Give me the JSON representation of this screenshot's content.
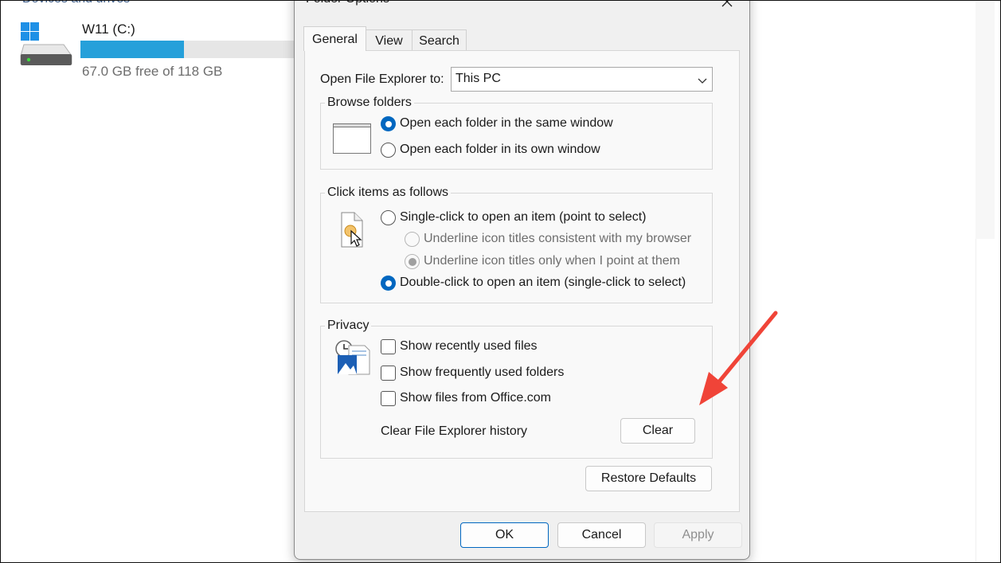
{
  "explorer": {
    "section_header": "Devices and drives",
    "drive": {
      "name": "W11 (C:)",
      "free_text": "67.0 GB free of 118 GB",
      "used_fraction": 0.432
    }
  },
  "dialog": {
    "title": "Folder Options",
    "tabs": [
      {
        "label": "General",
        "active": true
      },
      {
        "label": "View",
        "active": false
      },
      {
        "label": "Search",
        "active": false
      }
    ],
    "open_to": {
      "label": "Open File Explorer to:",
      "value": "This PC"
    },
    "browse_folders": {
      "title": "Browse folders",
      "options": [
        {
          "label": "Open each folder in the same window",
          "checked": true
        },
        {
          "label": "Open each folder in its own window",
          "checked": false
        }
      ]
    },
    "click_items": {
      "title": "Click items as follows",
      "single": "Single-click to open an item (point to select)",
      "underline_browser": "Underline icon titles consistent with my browser",
      "underline_point": "Underline icon titles only when I point at them",
      "double": "Double-click to open an item (single-click to select)"
    },
    "privacy": {
      "title": "Privacy",
      "checkboxes": [
        {
          "label": "Show recently used files",
          "checked": false
        },
        {
          "label": "Show frequently used folders",
          "checked": false
        },
        {
          "label": "Show files from Office.com",
          "checked": false
        }
      ],
      "clear_label": "Clear File Explorer history",
      "clear_button": "Clear"
    },
    "restore_button": "Restore Defaults",
    "ok_button": "OK",
    "cancel_button": "Cancel",
    "apply_button": "Apply"
  },
  "colors": {
    "accent": "#0067c0",
    "drive_fill": "#26a0da",
    "annotation_arrow": "#f04438"
  }
}
